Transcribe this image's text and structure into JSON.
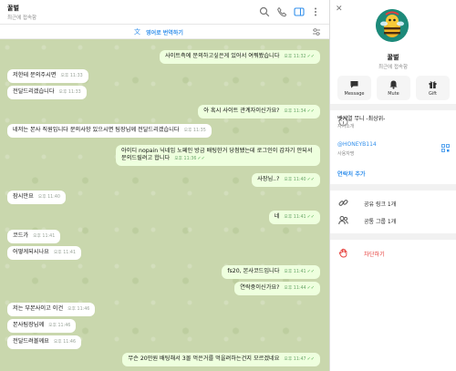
{
  "chat": {
    "title": "꿀벌",
    "subtitle": "최근에 접속함",
    "translate_label": "영어로 번역하기",
    "messages": [
      {
        "text": "사이트측에 문의하고싶은게 있어서 여쭤봤습니다",
        "time": "오후 11:32",
        "out": true,
        "read": true
      },
      {
        "text": "저한테 문의주시면",
        "time": "오후 11:33",
        "out": false
      },
      {
        "text": "전달드리겠습니다",
        "time": "오후 11:33",
        "out": false
      },
      {
        "text": "아 혹시 사이트 관계자이신가요?",
        "time": "오후 11:34",
        "out": true,
        "read": true
      },
      {
        "text": "네저는 본사 직원입니다 문의사항 있으시면 팀장님께 전달드리겠습니다",
        "time": "오후 11:35",
        "out": false
      },
      {
        "text": "아이디 nopain 닉네임 노페인 방금 배팅한거 당첨됐는데 로그인이 갑자기 안되서 문의드릴려고 합니다",
        "time": "오후 11:36",
        "out": true,
        "read": true
      },
      {
        "text": "사장님..?",
        "time": "오후 11:40",
        "out": true,
        "read": true
      },
      {
        "text": "잠시만요",
        "time": "오후 11:40",
        "out": false
      },
      {
        "text": "네",
        "time": "오후 11:41",
        "out": true,
        "read": true
      },
      {
        "text": "코드가",
        "time": "오후 11:41",
        "out": false
      },
      {
        "text": "어떻게되시나요",
        "time": "오후 11:41",
        "out": false
      },
      {
        "text": "fs20, 본사코드입니다",
        "time": "오후 11:41",
        "out": true,
        "read": true
      },
      {
        "text": "연락중이신가요?",
        "time": "오후 11:44",
        "out": true,
        "read": true
      },
      {
        "text": "저는 부본사이고 이건",
        "time": "오후 11:46",
        "out": false
      },
      {
        "text": "본사팀장님께",
        "time": "오후 11:46",
        "out": false
      },
      {
        "text": "전달드려볼께요",
        "time": "오후 11:46",
        "out": false
      },
      {
        "text": "무슨 20만원 배팅해서 3몰 먹은거를 먹을려하는건지 모르겠네요",
        "time": "오후 11:47",
        "out": true,
        "read": true
      }
    ]
  },
  "panel": {
    "name": "꿀벌",
    "status": "최근에 접속함",
    "actions": {
      "message": "Message",
      "mute": "Mute",
      "gift": "Gift"
    },
    "bio": "벳게열 무니 -최상위-",
    "bio_label": "자기소개",
    "username": "@HONEYB114",
    "username_label": "사용자명",
    "add_contact": "연락처 추가",
    "shared_links": "공유 링크 1개",
    "shared_groups": "공통 그룹 1개",
    "block": "차단하기"
  },
  "colors": {
    "accent": "#3390ec",
    "chat_bg": "#c9d7ad",
    "out_bubble": "#eeffde",
    "danger": "#e53935"
  }
}
